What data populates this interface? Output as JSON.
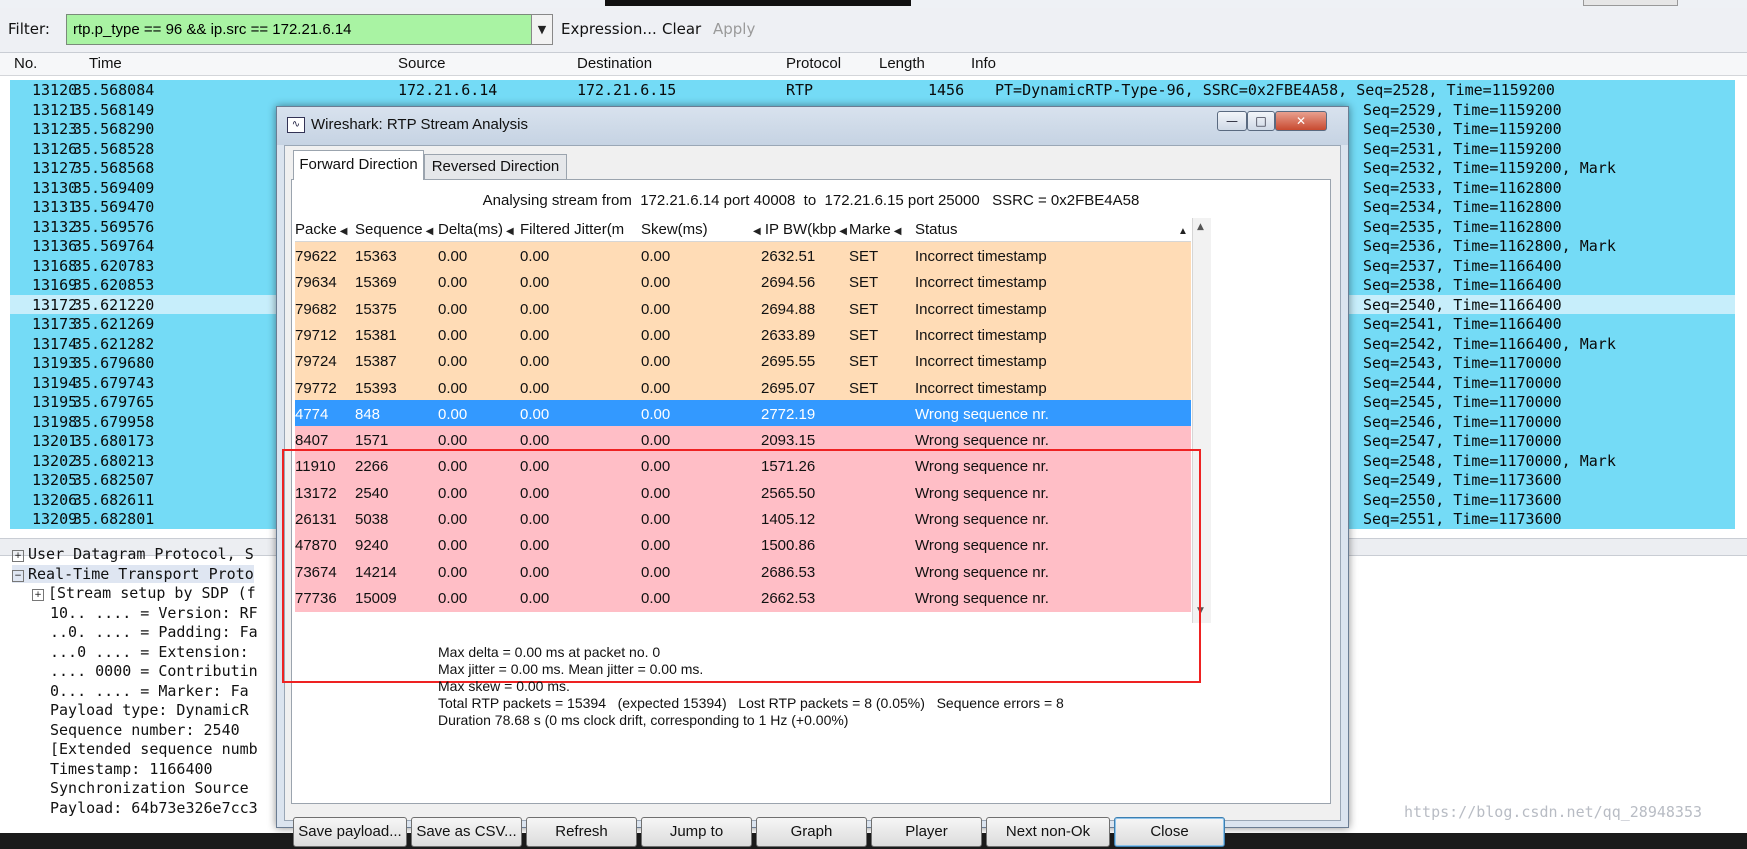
{
  "filter": {
    "label": "Filter:",
    "value": "rtp.p_type == 96 && ip.src == 172.21.6.14",
    "expression": "Expression...",
    "clear": "Clear",
    "apply": "Apply"
  },
  "columns": [
    "No.",
    "Time",
    "Source",
    "Destination",
    "Protocol",
    "Length",
    "Info"
  ],
  "packets": [
    {
      "no": "13120",
      "time": "35.568084",
      "src": "172.21.6.14",
      "dst": "172.21.6.15",
      "proto": "RTP",
      "len": "1456",
      "info": "PT=DynamicRTP-Type-96, SSRC=0x2FBE4A58, Seq=2528, Time=1159200"
    },
    {
      "no": "13121",
      "time": "35.568149",
      "info": "Seq=2529, Time=1159200"
    },
    {
      "no": "13123",
      "time": "35.568290",
      "info": "Seq=2530, Time=1159200"
    },
    {
      "no": "13126",
      "time": "35.568528",
      "info": "Seq=2531, Time=1159200"
    },
    {
      "no": "13127",
      "time": "35.568568",
      "info": "Seq=2532, Time=1159200, Mark"
    },
    {
      "no": "13130",
      "time": "35.569409",
      "info": "Seq=2533, Time=1162800"
    },
    {
      "no": "13131",
      "time": "35.569470",
      "info": "Seq=2534, Time=1162800"
    },
    {
      "no": "13132",
      "time": "35.569576",
      "info": "Seq=2535, Time=1162800"
    },
    {
      "no": "13136",
      "time": "35.569764",
      "info": "Seq=2536, Time=1162800, Mark"
    },
    {
      "no": "13168",
      "time": "35.620783",
      "info": "Seq=2537, Time=1166400"
    },
    {
      "no": "13169",
      "time": "35.620853",
      "info": "Seq=2538, Time=1166400"
    },
    {
      "no": "13172",
      "time": "35.621220",
      "info": "Seq=2540, Time=1166400"
    },
    {
      "no": "13173",
      "time": "35.621269",
      "info": "Seq=2541, Time=1166400"
    },
    {
      "no": "13174",
      "time": "35.621282",
      "info": "Seq=2542, Time=1166400, Mark"
    },
    {
      "no": "13193",
      "time": "35.679680",
      "info": "Seq=2543, Time=1170000"
    },
    {
      "no": "13194",
      "time": "35.679743",
      "info": "Seq=2544, Time=1170000"
    },
    {
      "no": "13195",
      "time": "35.679765",
      "info": "Seq=2545, Time=1170000"
    },
    {
      "no": "13198",
      "time": "35.679958",
      "info": "Seq=2546, Time=1170000"
    },
    {
      "no": "13201",
      "time": "35.680173",
      "info": "Seq=2547, Time=1170000"
    },
    {
      "no": "13202",
      "time": "35.680213",
      "info": "Seq=2548, Time=1170000, Mark"
    },
    {
      "no": "13205",
      "time": "35.682507",
      "info": "Seq=2549, Time=1173600"
    },
    {
      "no": "13206",
      "time": "35.682611",
      "info": "Seq=2550, Time=1173600"
    },
    {
      "no": "13209",
      "time": "35.682801",
      "info": "Seq=2551, Time=1173600"
    }
  ],
  "details": [
    "User Datagram Protocol, S",
    "Real-Time Transport Proto",
    "[Stream setup by SDP (f",
    "10.. .... = Version: RF",
    "..0. .... = Padding: Fa",
    "...0 .... = Extension:",
    ".... 0000 = Contributin",
    "0... .... = Marker: Fa",
    "Payload type: DynamicR",
    "Sequence number: 2540",
    "[Extended sequence numb",
    "Timestamp: 1166400",
    "Synchronization Source",
    "Payload: 64b73e326e7cc3"
  ],
  "dialog": {
    "title": "Wireshark: RTP Stream Analysis",
    "tabs": [
      "Forward Direction",
      "Reversed Direction"
    ],
    "analysing": "Analysing stream from  172.21.6.14 port 40008  to  172.21.6.15 port 25000   SSRC = 0x2FBE4A58",
    "table_headers": [
      "Packe",
      "Sequence",
      "Delta(ms)",
      "Filtered Jitter(m",
      "Skew(ms)",
      "IP BW(kbp",
      "Marke",
      "Status"
    ],
    "rows": [
      {
        "packet": "79622",
        "seq": "15363",
        "delta": "0.00",
        "jitter": "0.00",
        "skew": "0.00",
        "bw": "2632.51",
        "marker": "SET",
        "status": "Incorrect timestamp",
        "kind": "warn"
      },
      {
        "packet": "79634",
        "seq": "15369",
        "delta": "0.00",
        "jitter": "0.00",
        "skew": "0.00",
        "bw": "2694.56",
        "marker": "SET",
        "status": "Incorrect timestamp",
        "kind": "warn"
      },
      {
        "packet": "79682",
        "seq": "15375",
        "delta": "0.00",
        "jitter": "0.00",
        "skew": "0.00",
        "bw": "2694.88",
        "marker": "SET",
        "status": "Incorrect timestamp",
        "kind": "warn"
      },
      {
        "packet": "79712",
        "seq": "15381",
        "delta": "0.00",
        "jitter": "0.00",
        "skew": "0.00",
        "bw": "2633.89",
        "marker": "SET",
        "status": "Incorrect timestamp",
        "kind": "warn"
      },
      {
        "packet": "79724",
        "seq": "15387",
        "delta": "0.00",
        "jitter": "0.00",
        "skew": "0.00",
        "bw": "2695.55",
        "marker": "SET",
        "status": "Incorrect timestamp",
        "kind": "warn"
      },
      {
        "packet": "79772",
        "seq": "15393",
        "delta": "0.00",
        "jitter": "0.00",
        "skew": "0.00",
        "bw": "2695.07",
        "marker": "SET",
        "status": "Incorrect timestamp",
        "kind": "warn"
      },
      {
        "packet": "4774",
        "seq": "848",
        "delta": "0.00",
        "jitter": "0.00",
        "skew": "0.00",
        "bw": "2772.19",
        "marker": "",
        "status": "Wrong sequence nr.",
        "kind": "sel"
      },
      {
        "packet": "8407",
        "seq": "1571",
        "delta": "0.00",
        "jitter": "0.00",
        "skew": "0.00",
        "bw": "2093.15",
        "marker": "",
        "status": "Wrong sequence nr.",
        "kind": "err"
      },
      {
        "packet": "11910",
        "seq": "2266",
        "delta": "0.00",
        "jitter": "0.00",
        "skew": "0.00",
        "bw": "1571.26",
        "marker": "",
        "status": "Wrong sequence nr.",
        "kind": "err"
      },
      {
        "packet": "13172",
        "seq": "2540",
        "delta": "0.00",
        "jitter": "0.00",
        "skew": "0.00",
        "bw": "2565.50",
        "marker": "",
        "status": "Wrong sequence nr.",
        "kind": "err"
      },
      {
        "packet": "26131",
        "seq": "5038",
        "delta": "0.00",
        "jitter": "0.00",
        "skew": "0.00",
        "bw": "1405.12",
        "marker": "",
        "status": "Wrong sequence nr.",
        "kind": "err"
      },
      {
        "packet": "47870",
        "seq": "9240",
        "delta": "0.00",
        "jitter": "0.00",
        "skew": "0.00",
        "bw": "1500.86",
        "marker": "",
        "status": "Wrong sequence nr.",
        "kind": "err"
      },
      {
        "packet": "73674",
        "seq": "14214",
        "delta": "0.00",
        "jitter": "0.00",
        "skew": "0.00",
        "bw": "2686.53",
        "marker": "",
        "status": "Wrong sequence nr.",
        "kind": "err"
      },
      {
        "packet": "77736",
        "seq": "15009",
        "delta": "0.00",
        "jitter": "0.00",
        "skew": "0.00",
        "bw": "2662.53",
        "marker": "",
        "status": "Wrong sequence nr.",
        "kind": "err"
      }
    ],
    "stats": [
      "Max delta = 0.00 ms at packet no. 0",
      "Max jitter = 0.00 ms. Mean jitter = 0.00 ms.",
      "Max skew = 0.00 ms.",
      "Total RTP packets = 15394   (expected 15394)   Lost RTP packets = 8 (0.05%)   Sequence errors = 8",
      "Duration 78.68 s (0 ms clock drift, corresponding to 1 Hz (+0.00%)"
    ],
    "buttons": [
      "Save payload...",
      "Save as CSV...",
      "Refresh",
      "Jump to",
      "Graph",
      "Player",
      "Next non-Ok",
      "Close"
    ]
  },
  "watermark": "https://blog.csdn.net/qq_28948353",
  "colors": {
    "packet_row": "#74dbf6",
    "warn_row": "#ffdcb6",
    "error_row": "#ffbec6",
    "selected_row": "#3399ff",
    "filter_bg": "#a9f3a3"
  }
}
